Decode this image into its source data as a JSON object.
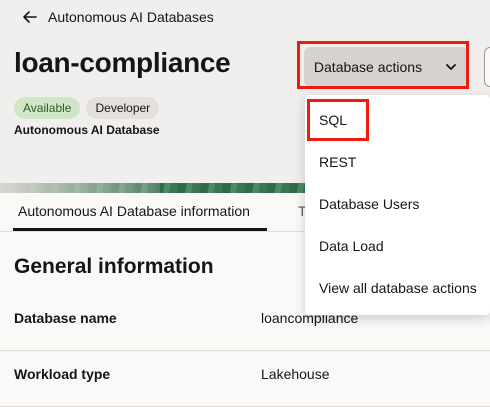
{
  "breadcrumb": {
    "back_label": "Autonomous AI Databases"
  },
  "page": {
    "title": "loan-compliance",
    "badges": [
      "Available",
      "Developer"
    ],
    "subtitle": "Autonomous AI Database"
  },
  "actions": {
    "button_label": "Database actions",
    "menu": [
      "SQL",
      "REST",
      "Database Users",
      "Data Load",
      "View all database actions"
    ]
  },
  "tabs": {
    "active": "Autonomous AI Database information",
    "next_partial": "T"
  },
  "section": {
    "title": "General information",
    "rows": [
      {
        "label": "Database name",
        "value": "loancompliance"
      },
      {
        "label": "Workload type",
        "value": "Lakehouse"
      }
    ]
  },
  "colors": {
    "highlight": "#ee1c0e",
    "available_badge": "#cfe6c7"
  }
}
